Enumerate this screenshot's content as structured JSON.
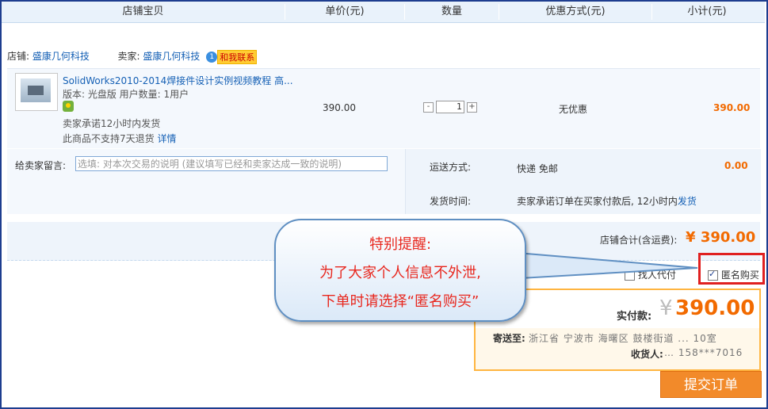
{
  "header": {
    "cols": [
      "店铺宝贝",
      "单价(元)",
      "数量",
      "优惠方式(元)",
      "小计(元)"
    ]
  },
  "shop": {
    "shop_label": "店铺:",
    "shop_name": "盛康几何科技",
    "seller_label": "卖家:",
    "seller_name": "盛康几何科技",
    "chat_label": "和我联系"
  },
  "item": {
    "title": "SolidWorks2010-2014焊接件设计实例视频教程 高...",
    "meta1": "版本: 光盘版  用户数量: 1用户",
    "promise": "卖家承诺12小时内发货",
    "no_return": "此商品不支持7天退货",
    "detail_link": "详情",
    "unit_price": "390.00",
    "qty": "1",
    "qty_minus": "-",
    "qty_plus": "+",
    "discount": "无优惠",
    "subtotal": "390.00"
  },
  "message": {
    "label": "给卖家留言:",
    "placeholder": "选填: 对本次交易的说明 (建议填写已经和卖家达成一致的说明)"
  },
  "shipping": {
    "method_label": "运送方式:",
    "method_value": "快递 免邮",
    "fee": "0.00",
    "time_label": "发货时间:",
    "time_value": "卖家承诺订单在买家付款后, 12小时内",
    "time_link": "发货"
  },
  "summary": {
    "label": "店铺合计(含运费):",
    "currency": "¥",
    "value": "390.00"
  },
  "options": {
    "proxy_pay": "找人代付",
    "anonymous": "匿名购买"
  },
  "pay": {
    "label": "实付款:",
    "currency": "¥",
    "value": "390.00",
    "address_label": "寄送至:",
    "address_value": "浙江省 宁波市 海曙区 鼓楼街道 ... 10室",
    "receiver_label": "收货人:",
    "receiver_value": "… 158***7016",
    "submit": "提交订单"
  },
  "callout": {
    "line1": "特别提醒:",
    "line2": "为了大家个人信息不外泄,",
    "line3": "下单时请选择“匿名购买”"
  },
  "colors": {
    "accent": "#f26a00",
    "link": "#1560b5",
    "highlight_box": "#e02020"
  }
}
